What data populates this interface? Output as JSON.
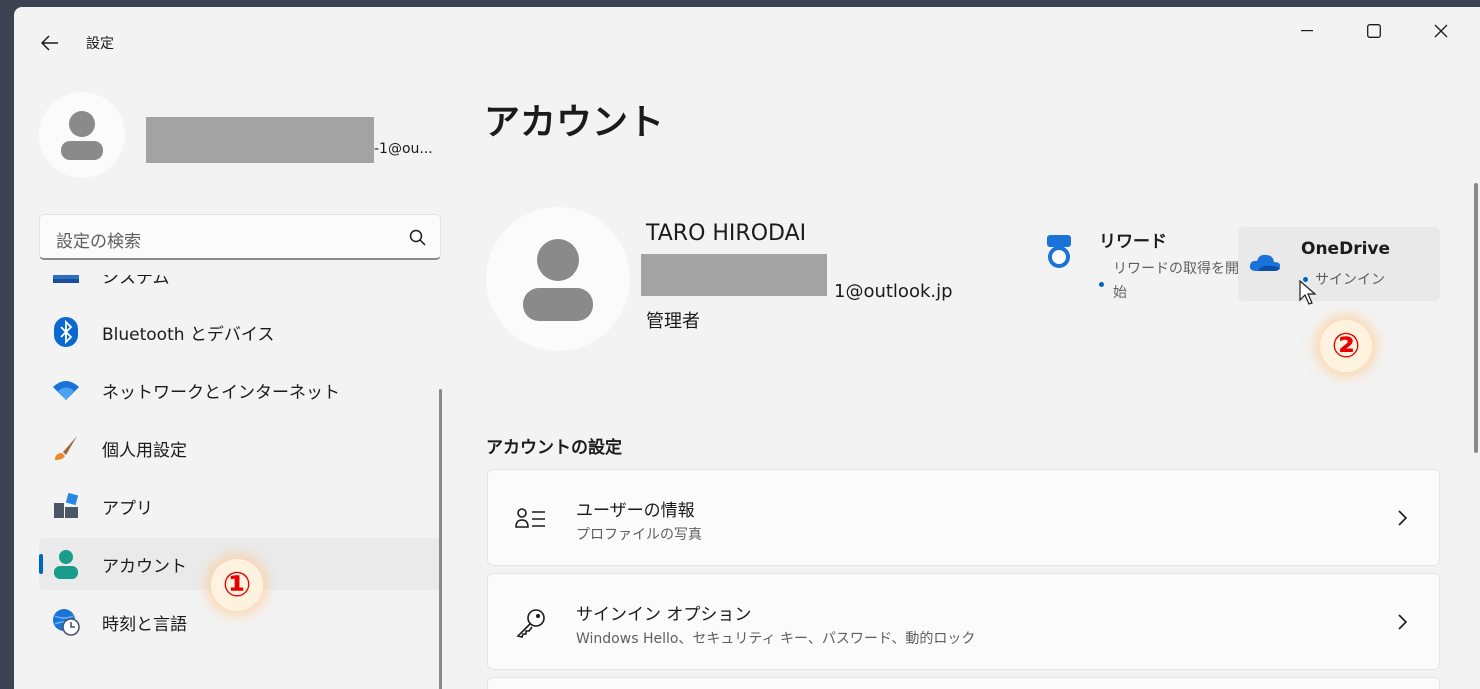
{
  "window": {
    "title": "設定"
  },
  "sidebar": {
    "email_suffix": "-1@ou...",
    "search_placeholder": "設定の検索",
    "items": [
      {
        "label": "システム",
        "icon": "system-icon"
      },
      {
        "label": "Bluetooth とデバイス",
        "icon": "bluetooth-icon"
      },
      {
        "label": "ネットワークとインターネット",
        "icon": "wifi-icon"
      },
      {
        "label": "個人用設定",
        "icon": "brush-icon"
      },
      {
        "label": "アプリ",
        "icon": "apps-icon"
      },
      {
        "label": "アカウント",
        "icon": "account-icon",
        "active": true
      },
      {
        "label": "時刻と言語",
        "icon": "clock-globe-icon"
      }
    ]
  },
  "annotations": {
    "one": "①",
    "two": "②"
  },
  "main": {
    "title": "アカウント",
    "user": {
      "name": "TARO HIRODAI",
      "email_suffix": "1@outlook.jp",
      "role": "管理者"
    },
    "reward": {
      "title": "リワード",
      "subtitle": "リワードの取得を開始"
    },
    "onedrive": {
      "title": "OneDrive",
      "subtitle": "サインイン"
    },
    "section_title": "アカウントの設定",
    "cards": [
      {
        "title": "ユーザーの情報",
        "subtitle": "プロファイルの写真",
        "icon": "user-info-icon"
      },
      {
        "title": "サインイン オプション",
        "subtitle": "Windows Hello、セキュリティ キー、パスワード、動的ロック",
        "icon": "key-icon"
      }
    ]
  },
  "colors": {
    "accent": "#0067c0",
    "annotation": "#e60000",
    "background": "#f3f3f3"
  }
}
